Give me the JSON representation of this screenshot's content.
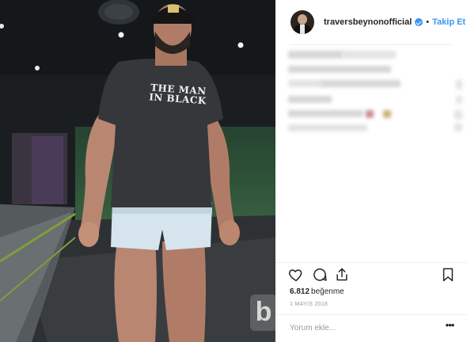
{
  "photo": {
    "shirt_text": "THE MAN IN BLACK",
    "watermark": "b"
  },
  "post": {
    "username": "traversbeynonofficial",
    "follow_separator": "•",
    "follow_label": "Takip Et",
    "likes_count": "6.812",
    "likes_label": "beğenme",
    "date": "1 MAYIS 2018",
    "comment_placeholder": "Yorum ekle...",
    "more_label": "•••"
  },
  "icons": {
    "like": "heart-icon",
    "comment": "comment-bubble-icon",
    "share": "share-icon",
    "save": "bookmark-icon",
    "verified": "verified-badge-icon"
  },
  "colors": {
    "link_blue": "#3897f0",
    "text": "#262626",
    "muted": "#999999",
    "divider": "#efefef"
  }
}
